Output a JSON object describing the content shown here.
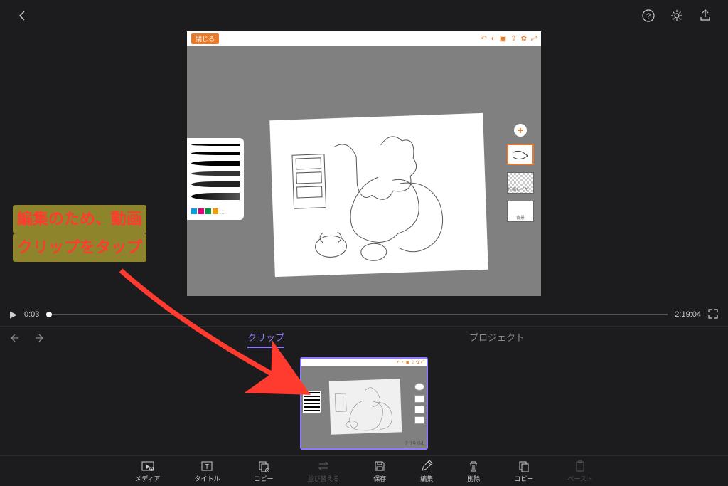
{
  "topbar": {
    "back": "‹"
  },
  "preview": {
    "close_label": "閉じる",
    "layers": {
      "l2_label": "作画レイヤー",
      "l3_label": "背景"
    }
  },
  "playbar": {
    "current_time": "0:03",
    "total_time": "2:19:04"
  },
  "tabs": {
    "clip": "クリップ",
    "project": "プロジェクト"
  },
  "clip": {
    "duration": "2:19:04"
  },
  "toolbar": {
    "media": "メディア",
    "title": "タイトル",
    "copy": "コピー",
    "reorder": "並び替える",
    "save": "保存",
    "edit": "編集",
    "delete": "削除",
    "copy2": "コピー",
    "paste": "ペースト"
  },
  "annotation": {
    "line1": "編集のため、動画",
    "line2": "クリップをタップ"
  }
}
